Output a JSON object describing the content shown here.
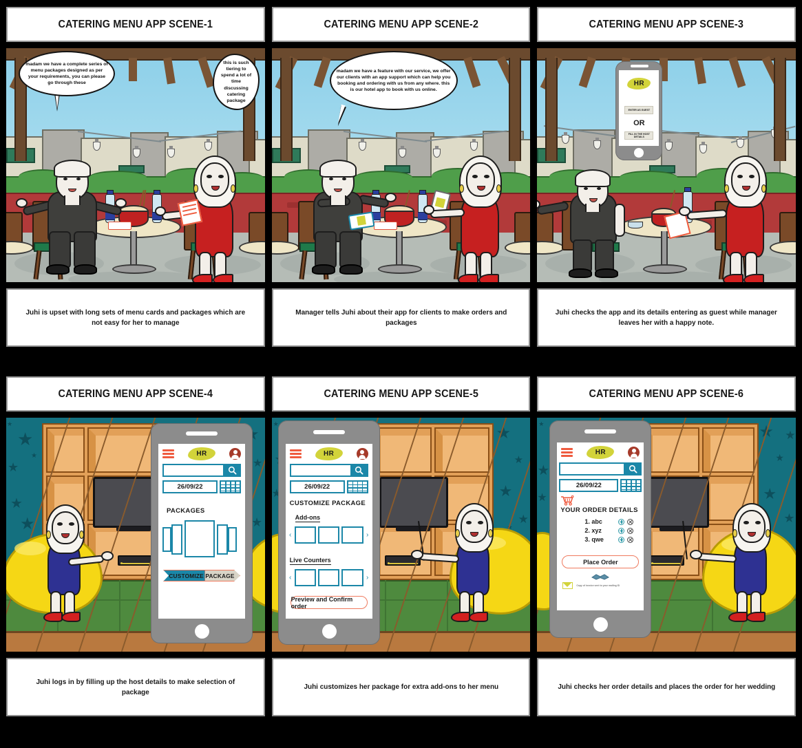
{
  "storyboard": {
    "title_prefix": "CATERING MENU APP",
    "panels": [
      {
        "id": "scene-1",
        "title": "CATERING MENU APP SCENE-1",
        "caption": "Juhi is upset with long sets of menu cards and packages which are not easy for her to manage",
        "background": "restaurant-patio",
        "bubbles": [
          {
            "speaker": "manager",
            "shape": "oval",
            "text": "madam we have a complete series of menu packages designed as per your requirements, you can please go through these"
          },
          {
            "speaker": "juhi",
            "shape": "cloud",
            "text": "this is such tiering to spend a lot of time discussing catering package"
          }
        ]
      },
      {
        "id": "scene-2",
        "title": "CATERING MENU APP SCENE-2",
        "caption": "Manager tells Juhi about their app for clients to make orders and packages",
        "background": "restaurant-patio",
        "bubbles": [
          {
            "speaker": "manager",
            "shape": "oval",
            "text": "madam we have a feature with our service, we offer our clients with an app support which can help you booking and ordering with us from any where. this is our hotel app to book with us online."
          }
        ]
      },
      {
        "id": "scene-3",
        "title": "CATERING MENU APP SCENE-3",
        "caption": "Juhi checks the app and its details entering as guest while manager leaves her with a happy note.",
        "background": "restaurant-patio",
        "bubbles": [],
        "phone": {
          "screen": "login",
          "logo": "HR",
          "guest_button": "ENTER AS GUEST",
          "divider": "OR",
          "host_button": "FILL IN THE HOST DETAILS"
        }
      },
      {
        "id": "scene-4",
        "title": "CATERING MENU APP SCENE-4",
        "caption": "Juhi logs in by filling up the host details to make selection of package",
        "background": "living-room",
        "bubbles": [],
        "phone": {
          "screen": "packages",
          "logo": "HR",
          "menu_icon": "hamburger-icon",
          "profile_icon": "avatar-icon",
          "search_value": "",
          "search_icon": "search-icon",
          "date_value": "26/09/22",
          "calendar_icon": "calendar-icon",
          "section_title": "PACKAGES",
          "cta_label": "CUSTOMIZE PACKAGE"
        }
      },
      {
        "id": "scene-5",
        "title": "CATERING MENU APP SCENE-5",
        "caption": "Juhi customizes her package for extra add-ons to her menu",
        "background": "living-room",
        "bubbles": [],
        "phone": {
          "screen": "customize",
          "logo": "HR",
          "menu_icon": "hamburger-icon",
          "profile_icon": "avatar-icon",
          "search_value": "",
          "search_icon": "search-icon",
          "date_value": "26/09/22",
          "calendar_icon": "calendar-icon",
          "section_title": "CUSTOMIZE PACKAGE",
          "group_1_label": "Add-ons",
          "group_2_label": "Live Counters",
          "prev_arrow": "‹",
          "next_arrow": "›",
          "cta_label": "Preview and Confirm order"
        }
      },
      {
        "id": "scene-6",
        "title": "CATERING MENU APP SCENE-6",
        "caption": "Juhi checks her order details and places the order for her wedding",
        "background": "living-room",
        "bubbles": [],
        "phone": {
          "screen": "order-details",
          "logo": "HR",
          "menu_icon": "hamburger-icon",
          "profile_icon": "avatar-icon",
          "search_value": "",
          "search_icon": "search-icon",
          "date_value": "26/09/22",
          "calendar_icon": "calendar-icon",
          "cart_icon": "shopping-cart-icon",
          "cart_badge": "0",
          "section_title": "YOUR ORDER DETAILS",
          "order_items": [
            {
              "label": "1. abc",
              "add_icon": "plus-circle-icon",
              "remove_icon": "close-circle-icon"
            },
            {
              "label": "2. xyz",
              "add_icon": "plus-circle-icon",
              "remove_icon": "close-circle-icon"
            },
            {
              "label": "3. qwe",
              "add_icon": "plus-circle-icon",
              "remove_icon": "close-circle-icon"
            }
          ],
          "cta_label": "Place Order",
          "handshake_icon": "handshake-icon",
          "mail_icon": "envelope-icon",
          "invoice_note": "Copy of invoice sent to your mailing ID"
        }
      }
    ]
  },
  "colors": {
    "page_background": "#000000",
    "panel_border": "#9a9a9a",
    "app_accent": "#1b87a8",
    "app_orange": "#ef5b3f",
    "app_logo_blob": "#d2d33a",
    "avatar": "#a63a2a",
    "restaurant_wall": "#b23a3a",
    "living_room_wall": "#14707f",
    "beanbag": "#f5d715",
    "dress_red": "#c62020",
    "dress_blue": "#2e3192"
  }
}
